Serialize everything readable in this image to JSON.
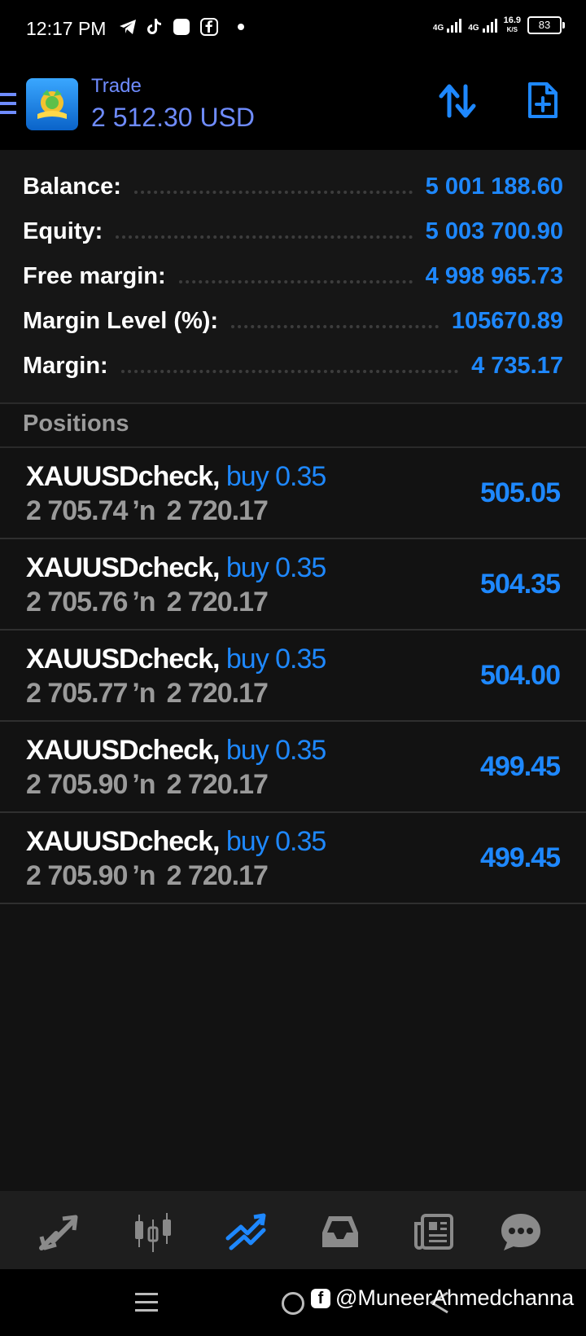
{
  "status_bar": {
    "time": "12:17 PM",
    "network1": "4G",
    "network2": "4G",
    "speed_value": "16.9",
    "speed_unit": "K/S",
    "battery": "83"
  },
  "header": {
    "title": "Trade",
    "subtitle": "2 512.30 USD"
  },
  "summary": [
    {
      "label": "Balance:",
      "value": "5 001 188.60"
    },
    {
      "label": "Equity:",
      "value": "5 003 700.90"
    },
    {
      "label": "Free margin:",
      "value": "4 998 965.73"
    },
    {
      "label": "Margin Level (%):",
      "value": "105670.89"
    },
    {
      "label": "Margin:",
      "value": "4 735.17"
    }
  ],
  "positions_header": "Positions",
  "positions": [
    {
      "symbol": "XAUUSDcheck,",
      "type": "buy 0.35",
      "open": "2 705.74",
      "arrow": "’n",
      "current": "2 720.17",
      "profit": "505.05"
    },
    {
      "symbol": "XAUUSDcheck,",
      "type": "buy 0.35",
      "open": "2 705.76",
      "arrow": "’n",
      "current": "2 720.17",
      "profit": "504.35"
    },
    {
      "symbol": "XAUUSDcheck,",
      "type": "buy 0.35",
      "open": "2 705.77",
      "arrow": "’n",
      "current": "2 720.17",
      "profit": "504.00"
    },
    {
      "symbol": "XAUUSDcheck,",
      "type": "buy 0.35",
      "open": "2 705.90",
      "arrow": "’n",
      "current": "2 720.17",
      "profit": "499.45"
    },
    {
      "symbol": "XAUUSDcheck,",
      "type": "buy 0.35",
      "open": "2 705.90",
      "arrow": "’n",
      "current": "2 720.17",
      "profit": "499.45"
    }
  ],
  "bottom_nav": [
    {
      "icon": "quotes-icon",
      "active": false
    },
    {
      "icon": "chart-icon",
      "active": false
    },
    {
      "icon": "trade-icon",
      "active": true
    },
    {
      "icon": "history-icon",
      "active": false
    },
    {
      "icon": "news-icon",
      "active": false
    },
    {
      "icon": "chat-icon",
      "active": false
    }
  ],
  "watermark": "@MuneerAhmedchanna",
  "colors": {
    "accent": "#1e88ff",
    "header_text": "#6f8cff",
    "muted": "#9a9a9a",
    "background": "#121212"
  }
}
